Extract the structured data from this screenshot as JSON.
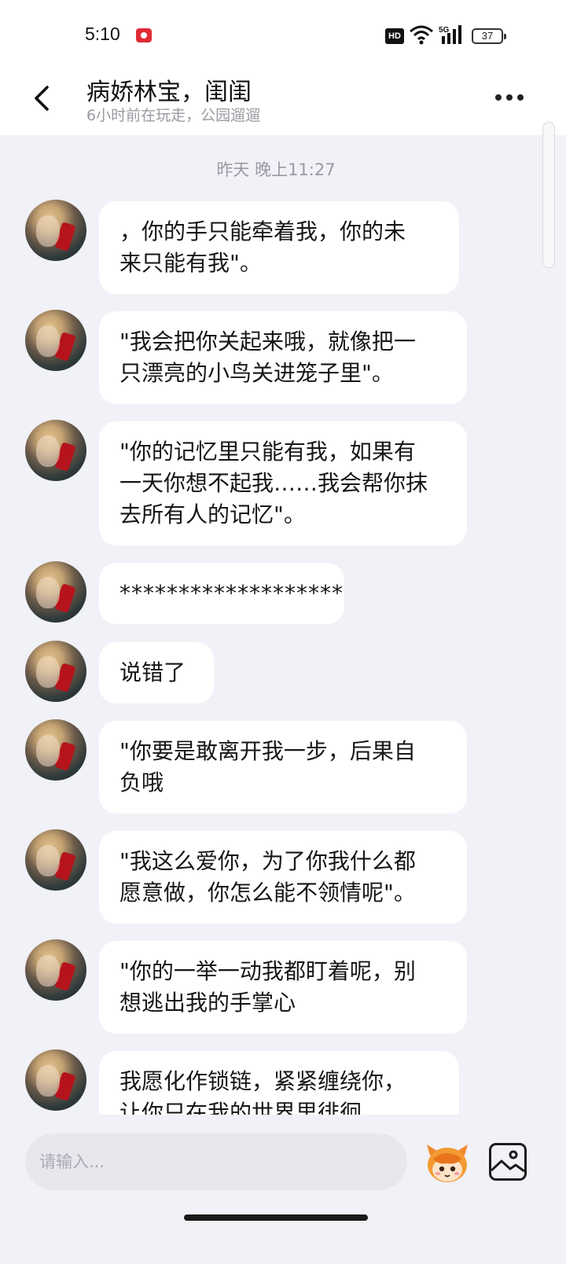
{
  "status_bar": {
    "time": "5:10",
    "network": "5G",
    "battery": "37"
  },
  "header": {
    "title": "病娇林宝，闺闺",
    "subtitle": "6小时前在玩走，公园遛遛"
  },
  "timestamp": "昨天 晚上11:27",
  "messages": [
    {
      "text": "，你的手只能牵着我，你的未\n来只能有我\"。"
    },
    {
      "text": "\"我会把你关起来哦，就像把一\n只漂亮的小鸟关进笼子里\"。"
    },
    {
      "text": "\"你的记忆里只能有我，如果有\n一天你想不起我……我会帮你抹\n去所有人的记忆\"。"
    },
    {
      "text": "*******************"
    },
    {
      "text": "说错了"
    },
    {
      "text": "\"你要是敢离开我一步，后果自\n负哦"
    },
    {
      "text": "\"我这么爱你，为了你我什么都\n愿意做，你怎么能不领情呢\"。"
    },
    {
      "text": "\"你的一举一动我都盯着呢，别\n想逃出我的手掌心"
    },
    {
      "text": "我愿化作锁链，紧紧缠绕你，\n让你只在我的世界里徘徊"
    }
  ],
  "input": {
    "placeholder": "请输入..."
  }
}
